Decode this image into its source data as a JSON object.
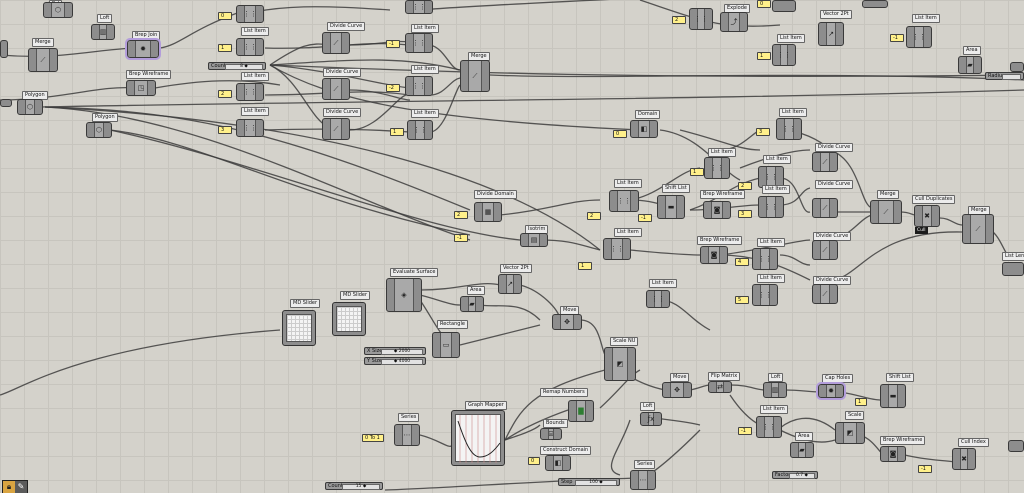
{
  "app": "Grasshopper",
  "colors": {
    "canvas": "#d4d2cb",
    "grid": "#c7c5be",
    "node_body": "#a9a9a9",
    "panel": "#fff08a",
    "wire": "#3d3d3d",
    "selected": "#b39ddb"
  },
  "labels": {
    "loft": "Loft",
    "merge": "Merge",
    "brep_join": "Brep Join",
    "brep_wireframe": "Brep Wireframe",
    "polygon": "Polygon",
    "list_item": "List Item",
    "divide_curve": "Divide Curve",
    "explode": "Explode",
    "vector_2pt": "Vector 2Pt",
    "area": "Area",
    "domain": "Domain",
    "shift_list": "Shift List",
    "cull_duplicates": "Cull Duplicates",
    "divide_domain": "Divide Domain",
    "isotrim": "Isotrim",
    "evaluate_surface": "Evaluate Surface",
    "md_slider": "MD Slider",
    "rectangle": "Rectangle",
    "move": "Move",
    "scale_nu": "Scale NU",
    "graph_mapper": "Graph Mapper",
    "remap_numbers": "Remap Numbers",
    "bounds": "Bounds",
    "construct_domain": "Construct Domain",
    "series": "Series",
    "flip_matrix": "Flip Matrix",
    "cap_holes": "Cap Holes",
    "scale": "Scale",
    "cull_index": "Cull Index",
    "list_length": "List Length",
    "cull": "Cull"
  },
  "sliders": {
    "count": {
      "name": "Count",
      "value": "8 ◆"
    },
    "x_size": {
      "name": "X Size",
      "value": "◆ 2000"
    },
    "y_size": {
      "name": "Y Size",
      "value": "◆ 4000"
    },
    "factor": {
      "name": "Factor",
      "value": "0.7 ◆"
    },
    "step": {
      "name": "Step",
      "value": "100 ◆"
    },
    "count2": {
      "name": "Count",
      "value": "15 ◆"
    },
    "radius": {
      "name": "Radius",
      "value": ""
    }
  },
  "panels": {
    "p1": "0",
    "p2": "1",
    "p3": "2",
    "p4": "3",
    "p5": "-1",
    "p6": "-2",
    "p7": "0 To 1",
    "p8": "4",
    "p9": "5",
    "p10": "1",
    "p11": "2",
    "p12": "3"
  },
  "toolbar": {
    "icons": [
      "lock-icon",
      "pen-icon"
    ]
  }
}
